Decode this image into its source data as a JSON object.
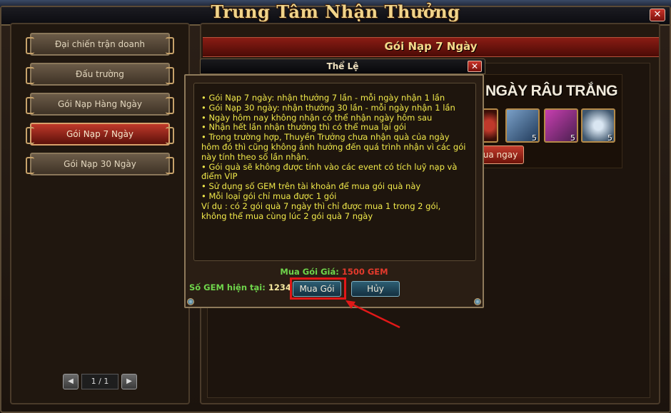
{
  "window": {
    "title": "Trung Tâm Nhận Thưởng",
    "close_label": "✕"
  },
  "sidebar": {
    "items": [
      {
        "label": "Đại chiến trận doanh",
        "active": false
      },
      {
        "label": "Đấu trường",
        "active": false
      },
      {
        "label": "Gói Nạp Hàng Ngày",
        "active": false
      },
      {
        "label": "Gói Nạp 7 Ngày",
        "active": true
      },
      {
        "label": "Gói Nạp 30 Ngày",
        "active": false
      }
    ],
    "pager": {
      "prev_icon": "◀",
      "page": "1 / 1",
      "next_icon": "▶"
    }
  },
  "main": {
    "header_title": "Gói Nạp 7 Ngày",
    "promo_title": "NGÀY RÂU TRẮNG",
    "item_counts": [
      "5",
      "5",
      "5"
    ],
    "buy_now_label": "ua ngay"
  },
  "dialog": {
    "title": "Thể Lệ",
    "close_label": "✕",
    "rules": [
      "• Gói Nạp 7 ngày: nhận thưởng 7 lần - mỗi ngày nhận 1 lần",
      "• Gói Nạp 30 ngày: nhận thưởng 30 lần - mỗi ngày nhận 1 lần",
      "• Ngày hôm nay không nhận có thể nhận ngày hôm sau",
      "• Nhận hết  lần nhận thưởng thì có thể mua lại gói",
      "• Trong trường hợp, Thuyền Trưởng chưa nhận quà của ngày hôm đó thì cũng không ảnh hưởng đến quá trình nhận vì các gói này tính theo số lần nhận.",
      "• Gói quà sẽ không được tính vào các event có tích luỹ nạp và điểm VIP",
      "• Sử dụng số GEM trên tài khoản để mua gói quà này",
      "• Mỗi loại gói chỉ mua được 1 gói",
      "Ví dụ : có 2 gói quà 7 ngày thì chỉ được mua 1 trong 2 gói, không thể mua cùng lúc 2 gói quà 7 ngày"
    ],
    "price_label": "Mua Gói Giá:",
    "price_value": "1500 GEM",
    "gem_label": "Số GEM hiện tại:",
    "gem_value": "1234",
    "buy_label": "Mua Gói",
    "cancel_label": "Hủy"
  },
  "colors": {
    "rule_text": "#f2ea4b",
    "price_label": "#6fd54b",
    "price_value": "#e33a2c",
    "highlight": "#e11818"
  }
}
